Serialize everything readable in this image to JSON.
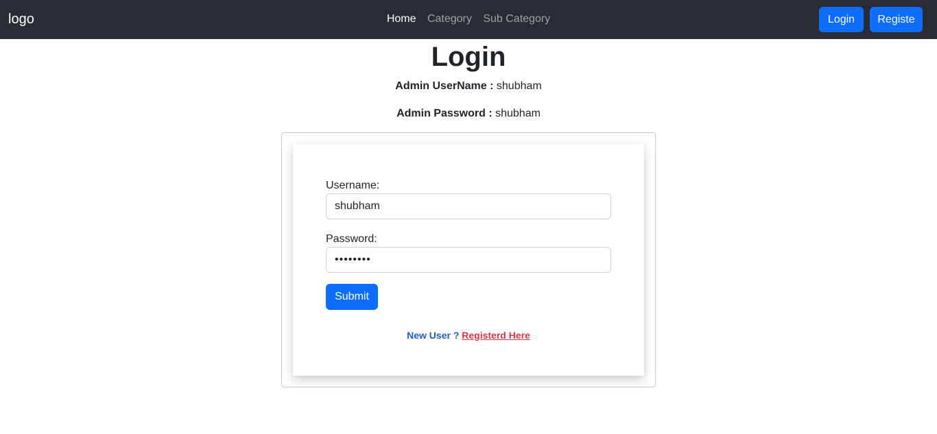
{
  "navbar": {
    "brand": "logo",
    "links": [
      {
        "label": "Home",
        "active": true
      },
      {
        "label": "Category",
        "active": false
      },
      {
        "label": "Sub Category",
        "active": false
      }
    ],
    "login_label": "Login",
    "register_label": "Registe",
    "background": "#292d33",
    "button_color": "#0d6efd"
  },
  "page": {
    "title": "Login",
    "admin_username_label": "Admin UserName :",
    "admin_username_value": "shubham",
    "admin_password_label": "Admin Password :",
    "admin_password_value": "shubham"
  },
  "form": {
    "username_label": "Username:",
    "username_value": "shubham",
    "password_label": "Password:",
    "password_value": "shubham1",
    "submit_label": "Submit",
    "new_user_text": "New User ?",
    "register_link": "Registerd Here",
    "link_color": "#dc3545"
  }
}
